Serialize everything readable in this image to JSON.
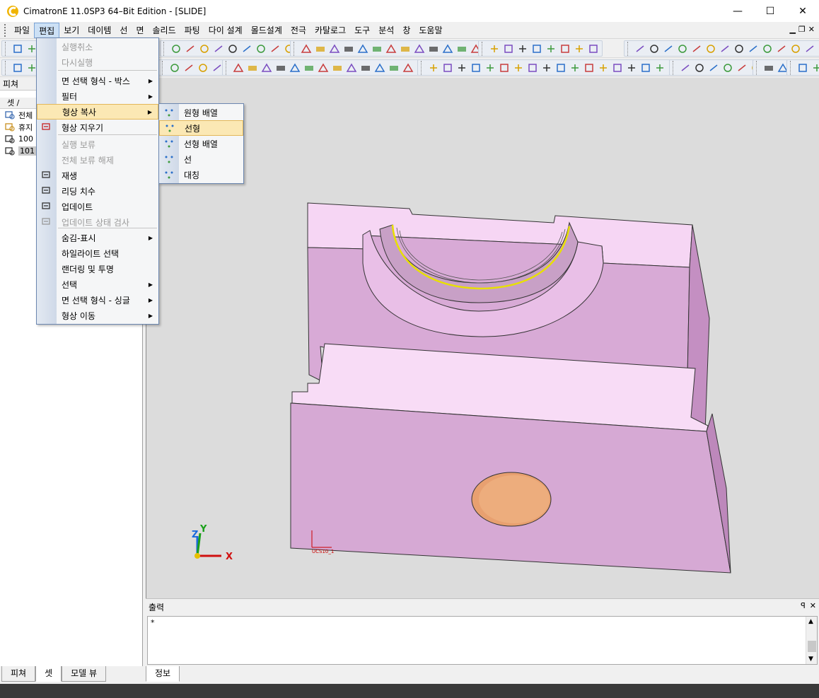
{
  "window": {
    "title": "CimatronE 11.0SP3 64–Bit Edition - [SLIDE]",
    "minimize_label": "—",
    "maximize_label": "☐",
    "close_label": "✕"
  },
  "menubar": {
    "items": [
      "파일",
      "편집",
      "보기",
      "데이템",
      "선",
      "면",
      "솔리드",
      "파팅",
      "다이 설계",
      "몰드설계",
      "전극",
      "카탈로그",
      "도구",
      "분석",
      "창",
      "도움말"
    ],
    "active_index": 1
  },
  "edit_menu": {
    "items": [
      {
        "label": "실행취소",
        "disabled": true
      },
      {
        "label": "다시실행",
        "disabled": true
      },
      {
        "label": "면 선택 형식 - 박스",
        "submenu": true
      },
      {
        "label": "필터",
        "submenu": true
      },
      {
        "label": "형상 복사",
        "submenu": true,
        "highlighted": true
      },
      {
        "label": "형상 지우기"
      },
      {
        "label": "실행 보류",
        "disabled": true
      },
      {
        "label": "전체 보류 해제",
        "disabled": true
      },
      {
        "label": "재생"
      },
      {
        "label": "리딩 치수"
      },
      {
        "label": "업데이트"
      },
      {
        "label": "업데이트 상태 검사",
        "disabled": true
      },
      {
        "label": "숨김-표시",
        "submenu": true
      },
      {
        "label": "하일라이트 선택"
      },
      {
        "label": "랜더링 및 투명"
      },
      {
        "label": "선택",
        "submenu": true
      },
      {
        "label": "면 선택 형식 - 싱글",
        "submenu": true
      },
      {
        "label": "형상 이동",
        "submenu": true
      }
    ]
  },
  "copy_submenu": {
    "items": [
      {
        "label": "원형 배열"
      },
      {
        "label": "선형",
        "highlighted": true
      },
      {
        "label": "선형 배열"
      },
      {
        "label": "선"
      },
      {
        "label": "대칭"
      }
    ]
  },
  "left_panel": {
    "title": "피쳐",
    "column_header": "셋 /",
    "rows": [
      {
        "label": "전체"
      },
      {
        "label": "휴지"
      },
      {
        "label": "100"
      },
      {
        "label": "101",
        "selected": true
      }
    ]
  },
  "left_tabs": [
    "피쳐",
    "셋",
    "모델 뷰"
  ],
  "left_tabs_active": 1,
  "output_panel": {
    "title": "출력",
    "pin_label": "ꟼ",
    "close_label": "✕",
    "text": "*",
    "tab": "정보"
  },
  "viewport": {
    "ucs_label": "UCS10_1",
    "axis_x": "X",
    "axis_y": "Y",
    "axis_z": "Z",
    "colors": {
      "background": "#dcdcdc",
      "part_face": "#d8aad6",
      "part_top": "#f4d0f2",
      "hole": "#e8a070",
      "highlight": "#e8e000"
    }
  }
}
